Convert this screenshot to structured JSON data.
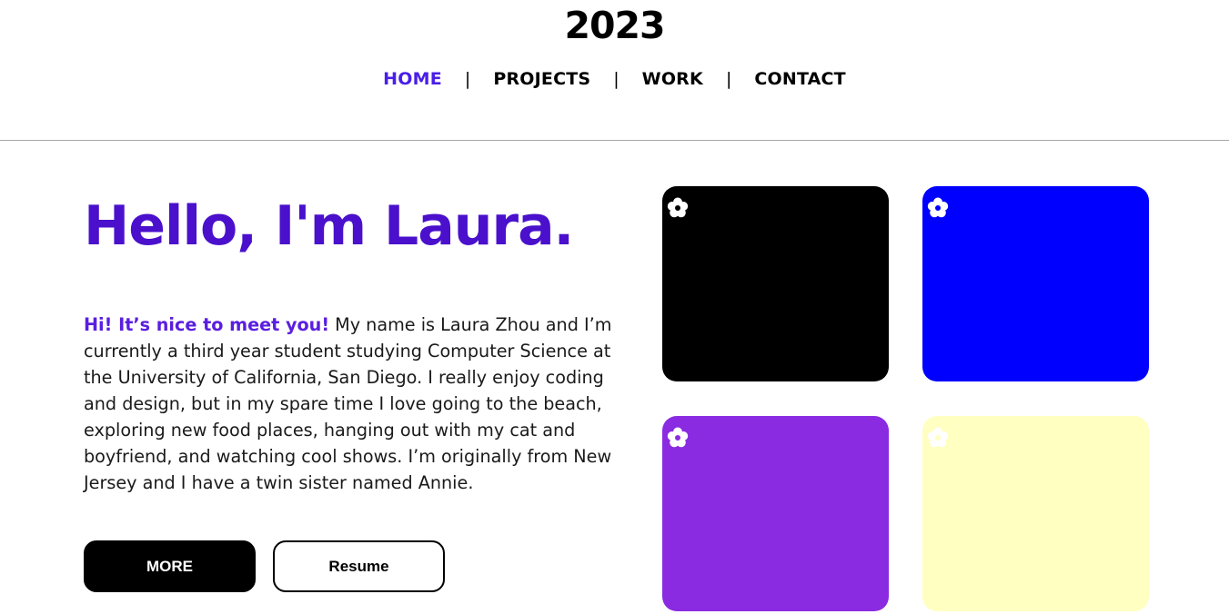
{
  "header": {
    "title": "2023",
    "nav": [
      {
        "label": "HOME",
        "active": true
      },
      {
        "label": "PROJECTS",
        "active": false
      },
      {
        "label": "WORK",
        "active": false
      },
      {
        "label": "CONTACT",
        "active": false
      }
    ],
    "separator": "|"
  },
  "hero": {
    "title": "Hello, I'm Laura.",
    "intro_lead": "Hi! It’s nice to meet you!",
    "intro_body": " My name is Laura Zhou and I’m currently a third year student studying Computer Science at the University of California, San Diego. I really enjoy coding and design, but in my spare time I love going to the beach, exploring new food places, hanging out with my cat and boyfriend, and watching cool shows. I’m originally from New Jersey and I have a twin sister named Annie.",
    "buttons": {
      "more_label": "MORE",
      "resume_label": "Resume"
    }
  },
  "cards": [
    {
      "color": "#000000",
      "icon": "flower-icon"
    },
    {
      "color": "#0000ff",
      "icon": "flower-icon"
    },
    {
      "color": "#8a2be2",
      "icon": "flower-icon"
    },
    {
      "color": "#ffffc2",
      "icon": "flower-icon"
    }
  ],
  "colors": {
    "accent": "#4a10cc",
    "nav_active": "#4a1ee8",
    "lead": "#5a1ee0",
    "divider": "#a6a6a6"
  }
}
